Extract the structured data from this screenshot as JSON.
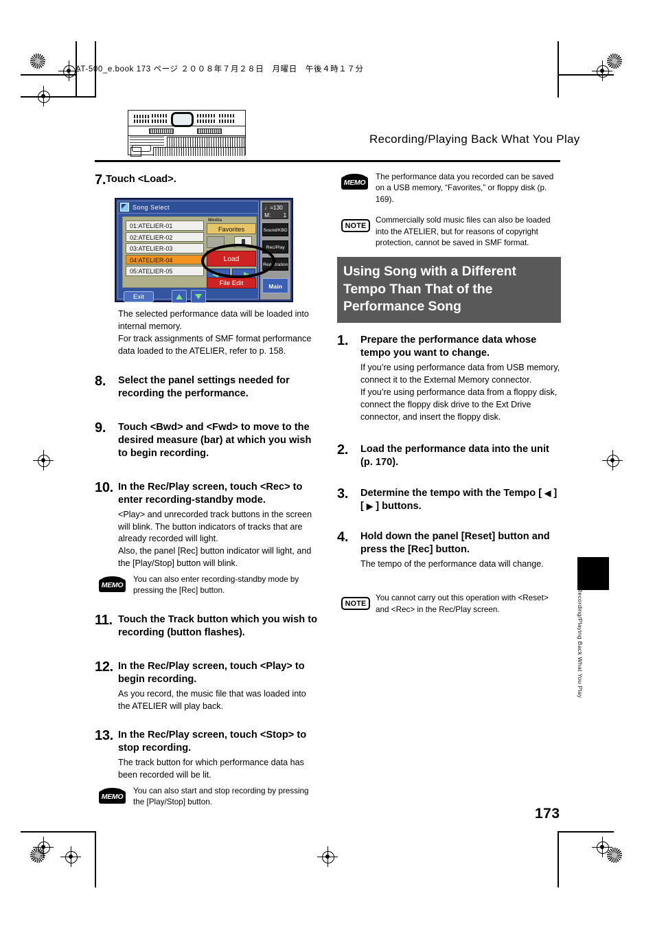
{
  "page": {
    "file_info": "AT-500_e.book  173 ページ  ２００８年７月２８日　月曜日　午後４時１７分",
    "running_head": "Recording/Playing Back What You Play",
    "page_number": "173",
    "side_tab": "Recording/Playing Back What You Play"
  },
  "lcd": {
    "title": "Song Select",
    "songs": [
      {
        "label": "01:ATELIER-01",
        "selected": false
      },
      {
        "label": "02:ATELIER-02",
        "selected": false
      },
      {
        "label": "03:ATELIER-03",
        "selected": false
      },
      {
        "label": "04:ATELIER-04",
        "selected": true
      },
      {
        "label": "05:ATELIER-05",
        "selected": false
      }
    ],
    "media_label": "Media",
    "favorites_button": "Favorites",
    "load_button": "Load",
    "file_edit_button": "File Edit",
    "exit_button": "Exit",
    "tempo_value": "=130",
    "measure_label": "M:",
    "measure_value": "1",
    "side_buttons": [
      "Sound/KBD",
      "Rec/Play",
      "Registration"
    ],
    "main_button": "Main",
    "highlight_color": "#f2921f",
    "load_color": "#cf2323"
  },
  "left_column": {
    "step7": {
      "num": "7.",
      "title": "Touch <Load>.",
      "body": "The selected performance data will be loaded into internal memory.\nFor track assignments of SMF format performance data loaded to the ATELIER, refer to p. 158."
    },
    "step8": {
      "num": "8.",
      "title": "Select the panel settings needed for recording the performance."
    },
    "step9": {
      "num": "9.",
      "title": "Touch <Bwd> and <Fwd> to move to the desired measure (bar) at which you wish to begin recording."
    },
    "step10": {
      "num": "10.",
      "title": "In the Rec/Play screen, touch <Rec> to enter recording-standby mode.",
      "body": "<Play> and unrecorded track buttons in the screen will blink. The button indicators of tracks that are already recorded will light.\nAlso, the panel [Rec] button indicator will light, and the [Play/Stop] button will blink.",
      "memo_badge": "MEMO",
      "memo": "You can also enter recording-standby mode by pressing the [Rec] button."
    },
    "step11": {
      "num": "11.",
      "title": "Touch the Track button which you wish to recording (button flashes)."
    },
    "step12": {
      "num": "12.",
      "title": "In the Rec/Play screen, touch <Play> to begin recording.",
      "body": "As you record, the music file that was loaded into the ATELIER will play back."
    },
    "step13": {
      "num": "13.",
      "title": "In the Rec/Play screen, touch <Stop> to stop recording.",
      "body": "The track button for which performance data has been recorded will be lit.",
      "memo_badge": "MEMO",
      "memo": "You can also start and stop recording by pressing the [Play/Stop] button."
    }
  },
  "right_column": {
    "memo_badge": "MEMO",
    "memo_top": "The performance data you recorded can be saved on a USB memory, “Favorites,” or floppy disk (p. 169).",
    "note_badge": "NOTE",
    "note_top": "Commercially sold music files can also be loaded into the ATELIER, but for reasons of copyright protection, cannot be saved in SMF format.",
    "section_heading": "Using Song with a Different Tempo Than That of the Performance Song",
    "section_heading_bg": "#595959",
    "step1": {
      "num": "1.",
      "title": "Prepare the performance data whose tempo you want to change.",
      "body": "If you’re using performance data from USB memory, connect it to the External Memory connector.\nIf you’re using performance data from a floppy disk, connect the floppy disk drive to the Ext Drive connector, and insert the floppy disk."
    },
    "step2": {
      "num": "2.",
      "title": "Load the performance data into the unit (p. 170)."
    },
    "step3": {
      "num": "3.",
      "title_a": "Determine the tempo with the Tempo [ ",
      "arrow_left": "◀",
      "title_b": " ] [ ",
      "arrow_right": "▶",
      "title_c": " ] buttons."
    },
    "step4": {
      "num": "4.",
      "title": "Hold down the panel [Reset] button and press the [Rec] button.",
      "body": "The tempo of the performance data will change."
    },
    "note_badge_bottom": "NOTE",
    "note_bottom": "You cannot carry out this operation with <Reset> and <Rec> in the Rec/Play screen."
  }
}
